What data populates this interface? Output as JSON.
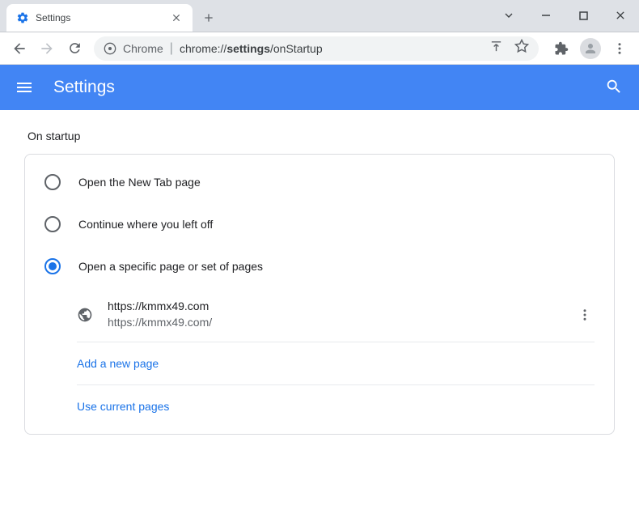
{
  "tab": {
    "title": "Settings"
  },
  "omnibox": {
    "label": "Chrome",
    "url": "chrome://settings/onStartup",
    "highlightPart": "settings"
  },
  "header": {
    "title": "Settings"
  },
  "section": {
    "title": "On startup"
  },
  "radios": [
    {
      "label": "Open the New Tab page",
      "selected": false
    },
    {
      "label": "Continue where you left off",
      "selected": false
    },
    {
      "label": "Open a specific page or set of pages",
      "selected": true
    }
  ],
  "pages": [
    {
      "title": "https://kmmx49.com",
      "url": "https://kmmx49.com/"
    }
  ],
  "actions": {
    "addPage": "Add a new page",
    "useCurrent": "Use current pages"
  }
}
